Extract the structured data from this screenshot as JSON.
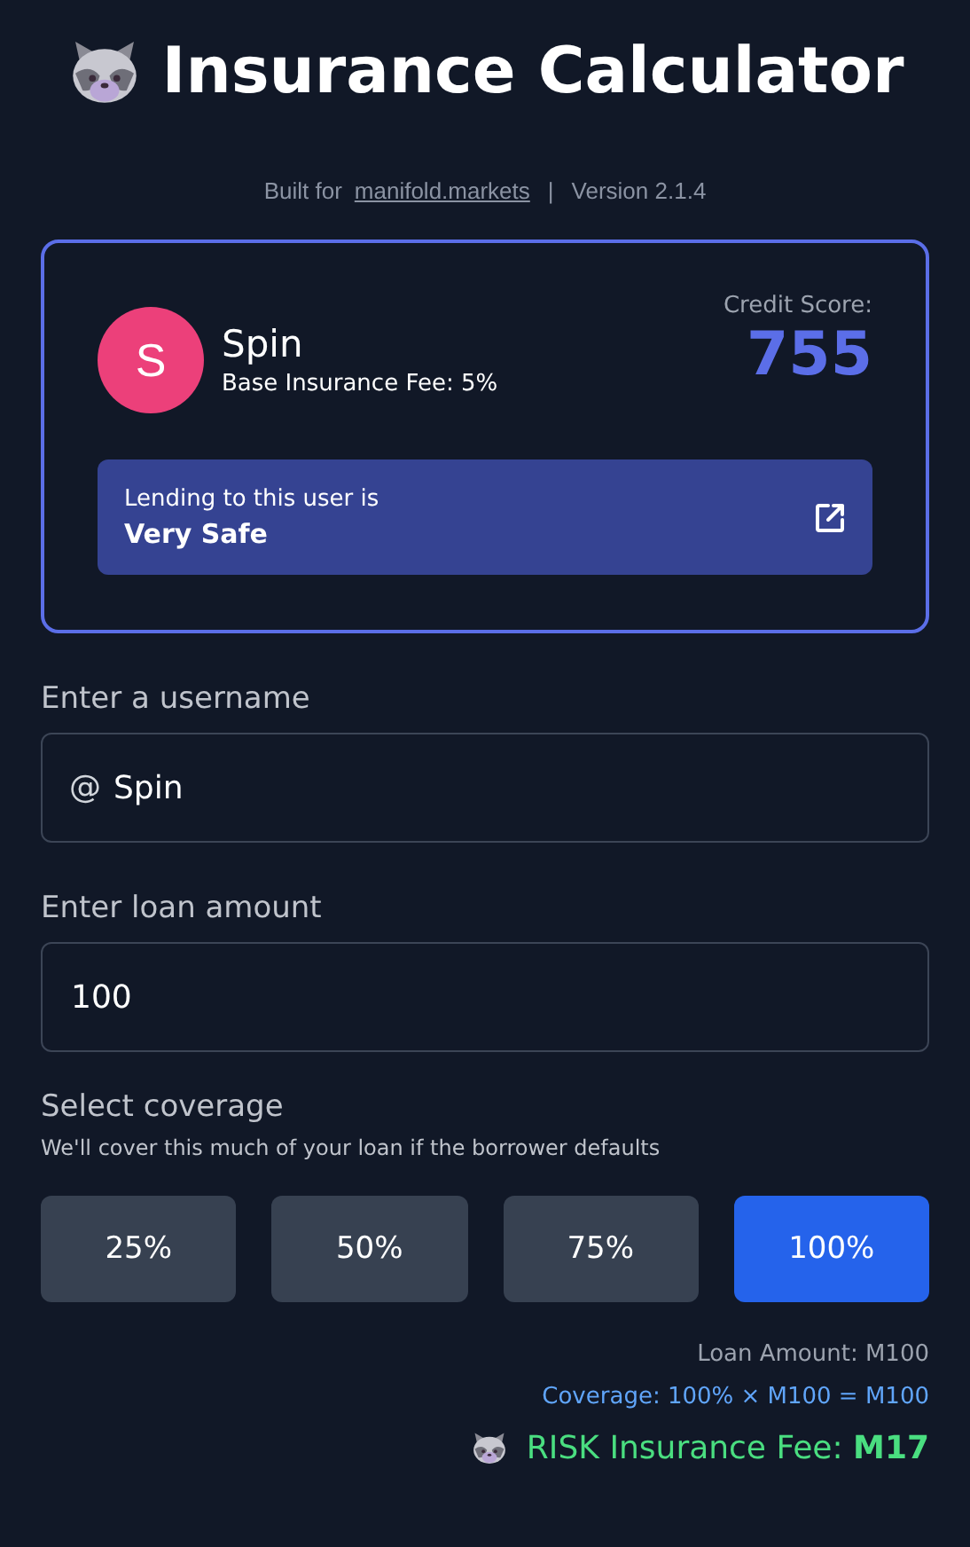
{
  "title": "Insurance Calculator",
  "subtitle": {
    "prefix": "Built for",
    "link": "manifold.markets",
    "separator": "|",
    "version": "Version 2.1.4"
  },
  "user_card": {
    "avatar_letter": "S",
    "name": "Spin",
    "base_fee": "Base Insurance Fee: 5%",
    "score_label": "Credit Score:",
    "score": "755",
    "verdict_intro": "Lending to this user is",
    "verdict": "Very Safe"
  },
  "username_field": {
    "label": "Enter a username",
    "prefix": "@",
    "value": "Spin"
  },
  "loan_field": {
    "label": "Enter loan amount",
    "value": "100"
  },
  "coverage": {
    "label": "Select coverage",
    "hint": "We'll cover this much of your loan if the borrower defaults",
    "options": [
      {
        "label": "25%",
        "selected": false
      },
      {
        "label": "50%",
        "selected": false
      },
      {
        "label": "75%",
        "selected": false
      },
      {
        "label": "100%",
        "selected": true
      }
    ]
  },
  "summary": {
    "loan_amount": "Loan Amount: M100",
    "coverage": "Coverage: 100% × M100 = M100",
    "fee": "RISK Insurance Fee: **M17**"
  }
}
